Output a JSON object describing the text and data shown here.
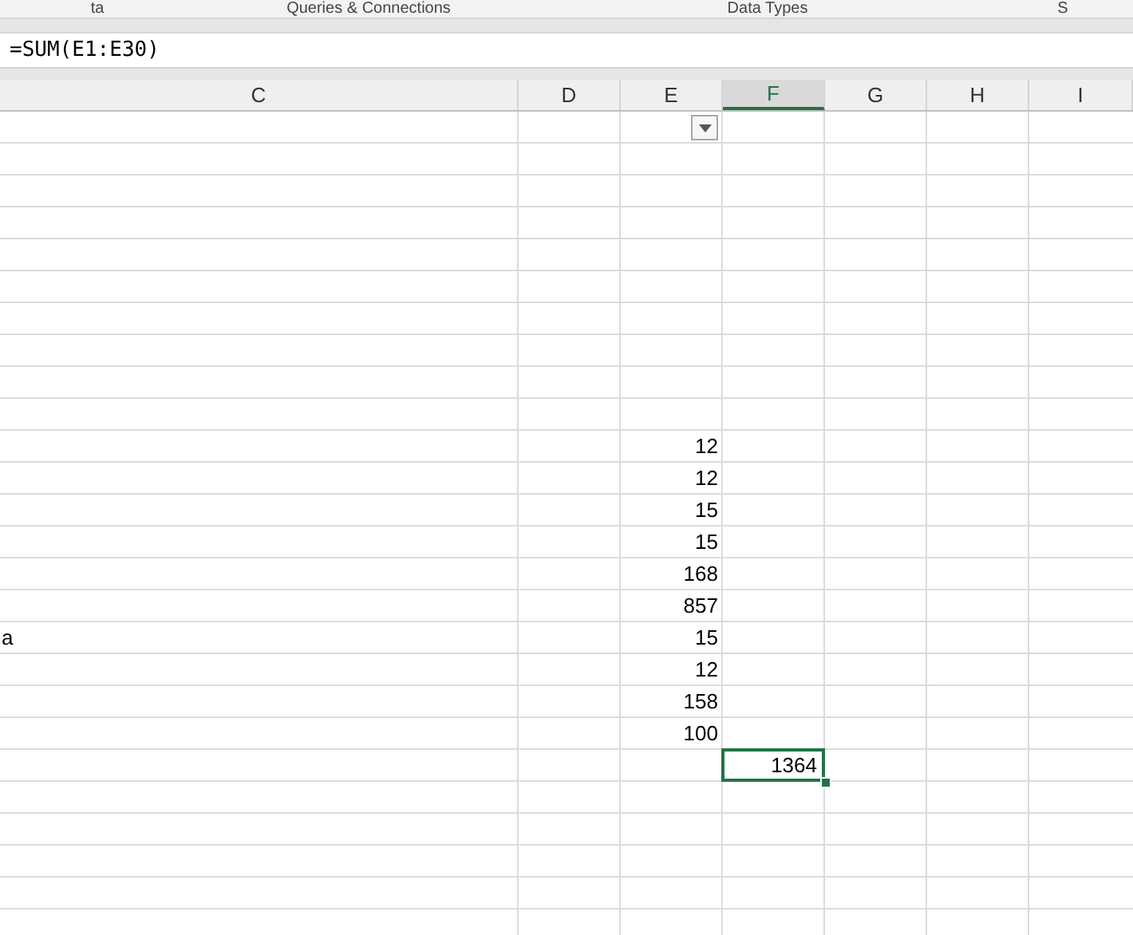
{
  "ribbon_groups": [
    "ta",
    "Queries & Connections",
    "Data Types",
    "S"
  ],
  "formula_bar": {
    "value": "=SUM(E1:E30)"
  },
  "columns": [
    {
      "label": "C",
      "selected": false
    },
    {
      "label": "D",
      "selected": false
    },
    {
      "label": "E",
      "selected": false
    },
    {
      "label": "F",
      "selected": true
    },
    {
      "label": "G",
      "selected": false
    },
    {
      "label": "H",
      "selected": false
    },
    {
      "label": "I",
      "selected": false
    }
  ],
  "rows": [
    {
      "cells": [
        null,
        null,
        {
          "kind": "filter"
        },
        null,
        null,
        null,
        null
      ]
    },
    {
      "cells": [
        null,
        null,
        null,
        null,
        null,
        null,
        null
      ]
    },
    {
      "cells": [
        null,
        null,
        null,
        null,
        null,
        null,
        null
      ]
    },
    {
      "cells": [
        null,
        null,
        null,
        null,
        null,
        null,
        null
      ]
    },
    {
      "cells": [
        null,
        null,
        null,
        null,
        null,
        null,
        null
      ]
    },
    {
      "cells": [
        null,
        null,
        null,
        null,
        null,
        null,
        null
      ]
    },
    {
      "cells": [
        null,
        null,
        null,
        null,
        null,
        null,
        null
      ]
    },
    {
      "cells": [
        null,
        null,
        null,
        null,
        null,
        null,
        null
      ]
    },
    {
      "cells": [
        null,
        null,
        null,
        null,
        null,
        null,
        null
      ]
    },
    {
      "cells": [
        null,
        null,
        null,
        null,
        null,
        null,
        null
      ]
    },
    {
      "cells": [
        null,
        null,
        {
          "kind": "number",
          "text": "12",
          "selected": false
        },
        null,
        null,
        null,
        null
      ]
    },
    {
      "cells": [
        null,
        null,
        {
          "kind": "number",
          "text": "12",
          "selected": false
        },
        null,
        null,
        null,
        null
      ]
    },
    {
      "cells": [
        null,
        null,
        {
          "kind": "number",
          "text": "15",
          "selected": false
        },
        null,
        null,
        null,
        null
      ]
    },
    {
      "cells": [
        null,
        null,
        {
          "kind": "number",
          "text": "15",
          "selected": false
        },
        null,
        null,
        null,
        null
      ]
    },
    {
      "cells": [
        null,
        null,
        {
          "kind": "number",
          "text": "168",
          "selected": false
        },
        null,
        null,
        null,
        null
      ]
    },
    {
      "cells": [
        null,
        null,
        {
          "kind": "number",
          "text": "857",
          "selected": false
        },
        null,
        null,
        null,
        null
      ]
    },
    {
      "cells": [
        {
          "kind": "text",
          "text": "a",
          "selected": false
        },
        null,
        {
          "kind": "number",
          "text": "15",
          "selected": false
        },
        null,
        null,
        null,
        null
      ]
    },
    {
      "cells": [
        null,
        null,
        {
          "kind": "number",
          "text": "12",
          "selected": false
        },
        null,
        null,
        null,
        null
      ]
    },
    {
      "cells": [
        null,
        null,
        {
          "kind": "number",
          "text": "158",
          "selected": false
        },
        null,
        null,
        null,
        null
      ]
    },
    {
      "cells": [
        null,
        null,
        {
          "kind": "number",
          "text": "100",
          "selected": false
        },
        null,
        null,
        null,
        null
      ]
    },
    {
      "cells": [
        null,
        null,
        null,
        {
          "kind": "number",
          "text": "1364",
          "selected": true
        },
        null,
        null,
        null
      ]
    }
  ]
}
